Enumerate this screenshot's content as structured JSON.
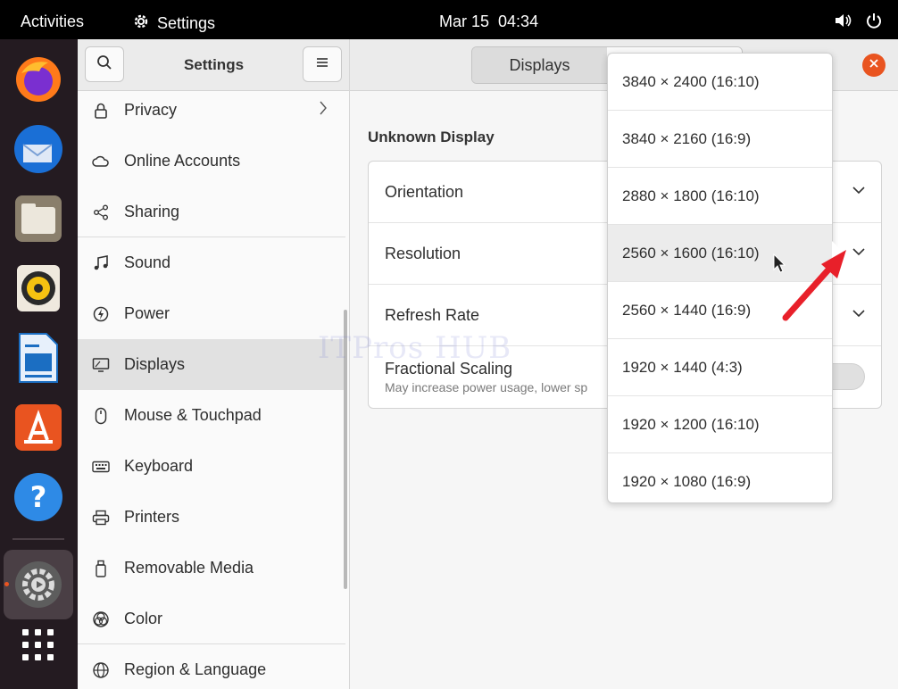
{
  "topbar": {
    "activities": "Activities",
    "app_name": "Settings",
    "date": "Mar 15",
    "time": "04:34"
  },
  "dock": {
    "apps": [
      "Firefox",
      "Thunderbird",
      "Files",
      "Rhythmbox",
      "LibreOffice Writer",
      "Ubuntu Software",
      "Help",
      "Settings",
      "Show Applications"
    ]
  },
  "sidebar": {
    "title": "Settings",
    "items": [
      {
        "label": "Privacy",
        "icon": "lock-icon"
      },
      {
        "label": "Online Accounts",
        "icon": "cloud-icon"
      },
      {
        "label": "Sharing",
        "icon": "share-icon"
      },
      {
        "label": "Sound",
        "icon": "music-note-icon"
      },
      {
        "label": "Power",
        "icon": "power-icon"
      },
      {
        "label": "Displays",
        "icon": "display-icon"
      },
      {
        "label": "Mouse & Touchpad",
        "icon": "mouse-icon"
      },
      {
        "label": "Keyboard",
        "icon": "keyboard-icon"
      },
      {
        "label": "Printers",
        "icon": "printer-icon"
      },
      {
        "label": "Removable Media",
        "icon": "usb-drive-icon"
      },
      {
        "label": "Color",
        "icon": "color-icon"
      },
      {
        "label": "Region & Language",
        "icon": "globe-icon"
      }
    ]
  },
  "main": {
    "tab": "Displays",
    "display_name": "Unknown Display",
    "rows": {
      "orientation": "Orientation",
      "resolution": "Resolution",
      "refresh_rate": "Refresh Rate",
      "fractional_scaling": "Fractional Scaling",
      "fractional_scaling_sub": "May increase power usage, lower sp"
    }
  },
  "resolution_menu": {
    "options": [
      "3840 × 2400 (16:10)",
      "3840 × 2160 (16:9)",
      "2880 × 1800 (16:10)",
      "2560 × 1600 (16:10)",
      "2560 × 1440 (16:9)",
      "1920 × 1440 (4:3)",
      "1920 × 1200 (16:10)",
      "1920 × 1080 (16:9)"
    ],
    "hovered": "2560 × 1600 (16:10)"
  },
  "watermark": "ITPros HUB",
  "colors": {
    "accent": "#e95420",
    "dock_bg": "#241b21",
    "arrow": "#e8202a"
  }
}
